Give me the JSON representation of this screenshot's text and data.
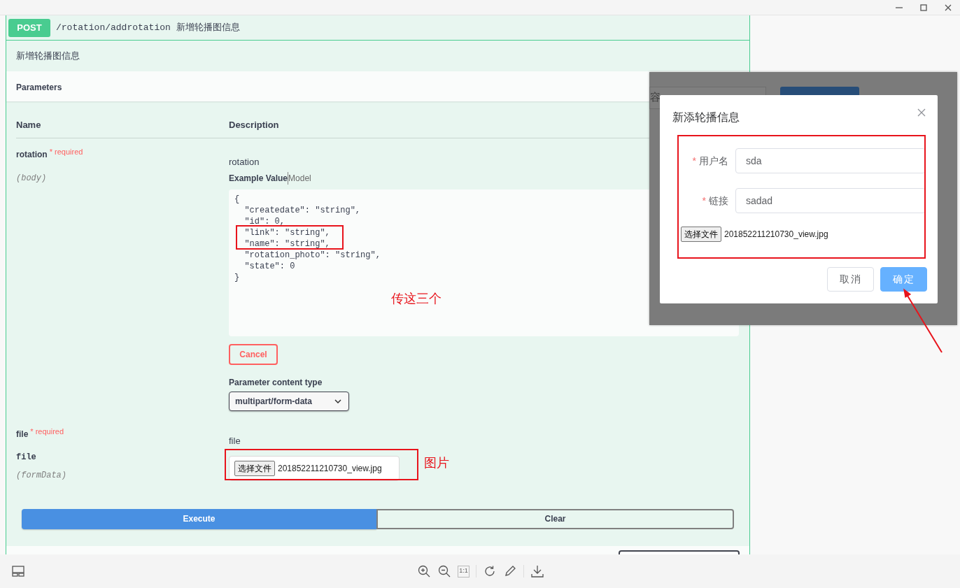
{
  "operation": {
    "method": "POST",
    "path": "/rotation/addrotation",
    "summary": "新增轮播图信息",
    "description": "新增轮播图信息"
  },
  "parameters_title": "Parameters",
  "columns": [
    "Name",
    "Description"
  ],
  "params": [
    {
      "kind": "body",
      "name": "rotation",
      "required_mark": "*",
      "required_label": "required",
      "location": "(body)",
      "description": "rotation",
      "example_tabs": [
        {
          "label": "Example Value",
          "selected": true
        },
        {
          "label": "Model",
          "selected": false
        }
      ],
      "example": "{\n  \"createdate\": \"string\",\n  \"id\": 0,\n  \"link\": \"string\",\n  \"name\": \"string\",\n  \"rotation_photo\": \"string\",\n  \"state\": 0\n}",
      "cancel": "Cancel",
      "content_type_label": "Parameter content type",
      "content_type": "multipart/form-data"
    },
    {
      "kind": "file",
      "name": "file",
      "required_mark": "*",
      "required_label": "required",
      "type": "file",
      "location": "(formData)",
      "description": "file",
      "file_button": "选择文件",
      "file_name": "201852211210730_view.jpg"
    }
  ],
  "actions": [
    {
      "label": "Execute",
      "kind": "primary"
    },
    {
      "label": "Clear",
      "kind": "secondary"
    }
  ],
  "dialog": {
    "background_text": "容",
    "title": "新添轮播信息",
    "fields": [
      {
        "label": "用户名",
        "required_mark": "*",
        "value": "sda"
      },
      {
        "label": "链接",
        "required_mark": "*",
        "value": "sadad"
      }
    ],
    "file_button": "选择文件",
    "file_name": "201852211210730_view.jpg",
    "buttons": [
      {
        "label": "取消",
        "kind": "default"
      },
      {
        "label": "确定",
        "kind": "primary"
      }
    ]
  },
  "annotations": [
    {
      "text": "传这三个"
    },
    {
      "text": "图片"
    }
  ],
  "viewer_toolbar": {
    "actual_size": "1:1"
  }
}
